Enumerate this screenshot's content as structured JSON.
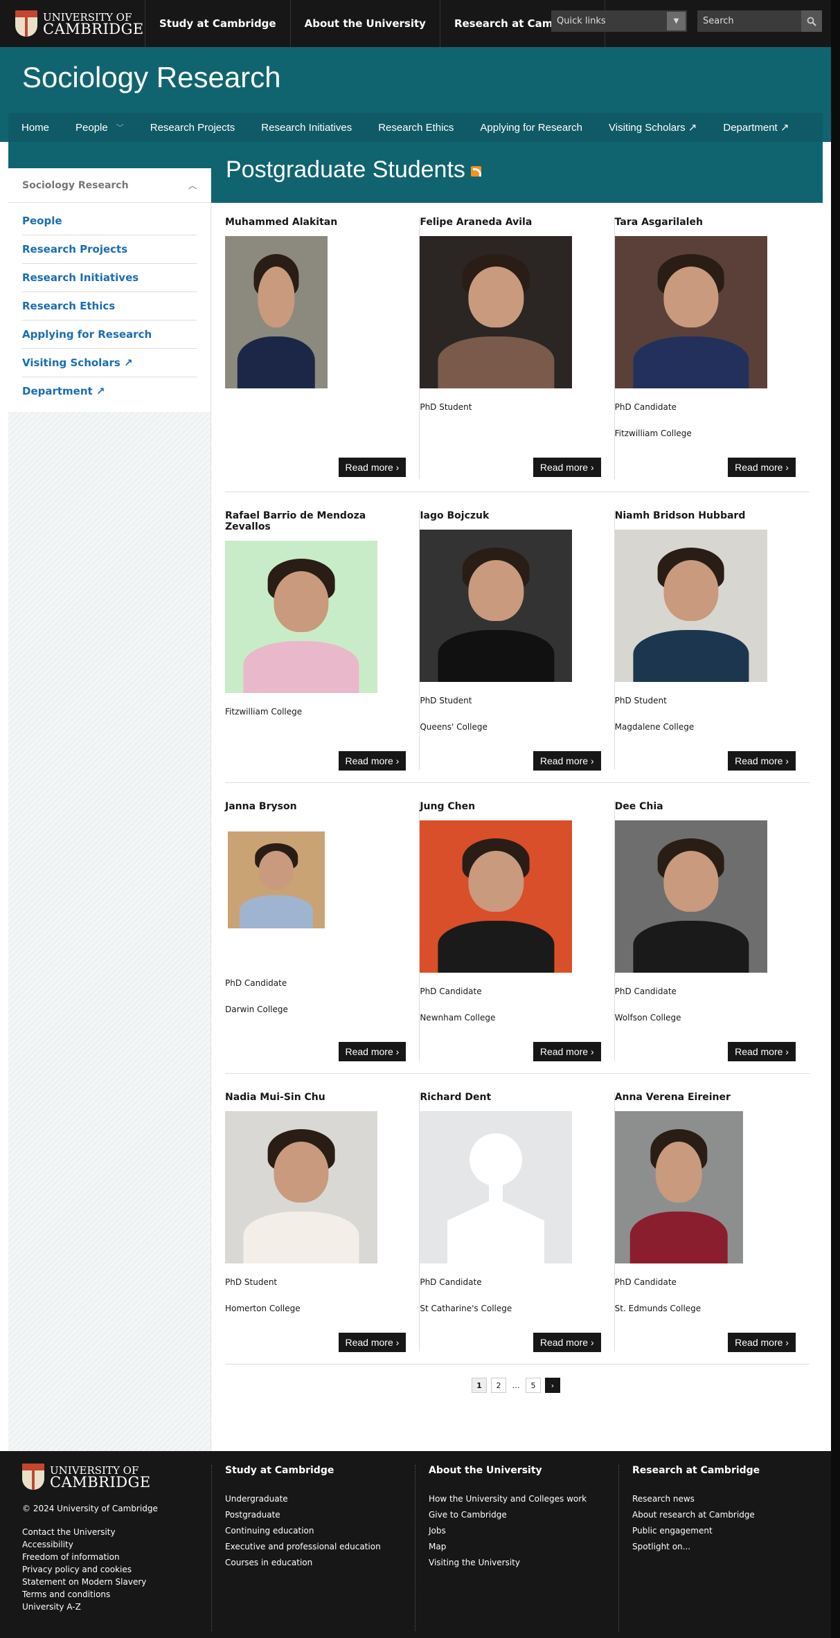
{
  "brand": {
    "line1": "UNIVERSITY OF",
    "line2": "CAMBRIDGE"
  },
  "topnav": [
    "Study at Cambridge",
    "About the University",
    "Research at Cambridge"
  ],
  "quick_links": "Quick links",
  "search_placeholder": "Search",
  "site_title": "Sociology Research",
  "mainnav": [
    "Home",
    "People",
    "Research Projects",
    "Research Initiatives",
    "Research Ethics",
    "Applying for Research",
    "Visiting Scholars ↗",
    "Department ↗"
  ],
  "sidebar": {
    "heading": "Sociology Research",
    "items": [
      "People",
      "Research Projects",
      "Research Initiatives",
      "Research Ethics",
      "Applying for Research",
      "Visiting Scholars ↗",
      "Department ↗"
    ]
  },
  "page_title": "Postgraduate Students",
  "read_more": "Read more",
  "people": [
    {
      "name": "Muhammed Alakitan",
      "role": "",
      "college": "",
      "photo": "man-suit-cloister"
    },
    {
      "name": "Felipe Araneda Avila",
      "role": "PhD Student",
      "college": "",
      "photo": "man-dark-background"
    },
    {
      "name": "Tara Asgarilaleh",
      "role": "PhD Candidate",
      "college": "Fitzwilliam College",
      "photo": "woman-brick-wall"
    },
    {
      "name": "Rafael Barrio de Mendoza Zevallos",
      "role": "Fitzwilliam College",
      "college": "",
      "photo": "man-curly-hair-glasses"
    },
    {
      "name": "Iago Bojczuk",
      "role": "PhD Student",
      "college": "Queens' College",
      "photo": "man-bw-suit"
    },
    {
      "name": "Niamh Bridson Hubbard",
      "role": "PhD Student",
      "college": "Magdalene College",
      "photo": "woman-blonde"
    },
    {
      "name": "Janna Bryson",
      "role": "PhD Candidate",
      "college": "Darwin College",
      "photo": "woman-brown-hair"
    },
    {
      "name": "Jung Chen",
      "role": "PhD Candidate",
      "college": "Newnham College",
      "photo": "woman-rainbow-flag"
    },
    {
      "name": "Dee Chia",
      "role": "PhD Candidate",
      "college": "Wolfson College",
      "photo": "person-glasses"
    },
    {
      "name": "Nadia Mui-Sin Chu",
      "role": "PhD Student",
      "college": "Homerton College",
      "photo": "woman-long-hair"
    },
    {
      "name": "Richard Dent",
      "role": "PhD Candidate",
      "college": "St Catharine's College",
      "photo": "placeholder-silhouette"
    },
    {
      "name": "Anna Verena Eireiner",
      "role": "PhD Candidate",
      "college": "St. Edmunds College",
      "photo": "woman-red-scarf"
    }
  ],
  "pagination": {
    "pages": [
      "1",
      "2",
      "…",
      "5"
    ],
    "current": "1"
  },
  "footer": {
    "copyright": "© 2024 University of Cambridge",
    "links": [
      "Contact the University",
      "Accessibility",
      "Freedom of information",
      "Privacy policy and cookies",
      "Statement on Modern Slavery",
      "Terms and conditions",
      "University A-Z"
    ],
    "study": {
      "title": "Study at Cambridge",
      "items": [
        "Undergraduate",
        "Postgraduate",
        "Continuing education",
        "Executive and professional education",
        "Courses in education"
      ]
    },
    "about": {
      "title": "About the University",
      "items": [
        "How the University and Colleges work",
        "Give to Cambridge",
        "Jobs",
        "Map",
        "Visiting the University"
      ]
    },
    "research": {
      "title": "Research at Cambridge",
      "items": [
        "Research news",
        "About research at Cambridge",
        "Public engagement",
        "Spotlight on..."
      ]
    }
  },
  "colors": {
    "teal": "#106470",
    "dark": "#171717",
    "link": "#1a6db3"
  }
}
